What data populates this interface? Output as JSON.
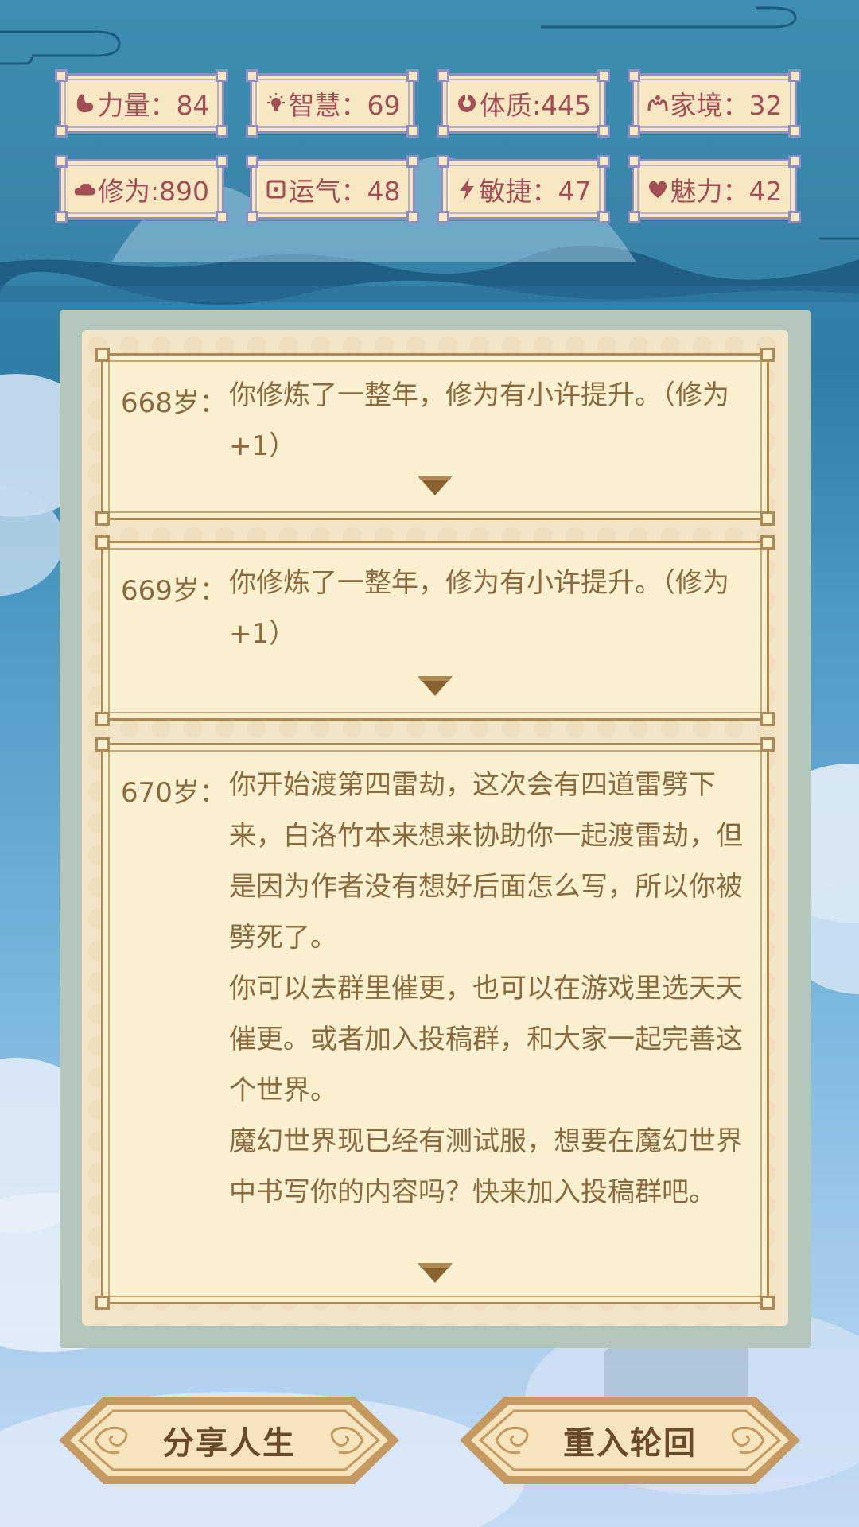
{
  "stats": [
    {
      "icon": "arm-icon",
      "text": "力量：84"
    },
    {
      "icon": "bulb-icon",
      "text": "智慧：69"
    },
    {
      "icon": "body-icon",
      "text": "体质:445"
    },
    {
      "icon": "family-icon",
      "text": "家境：32"
    },
    {
      "icon": "cloud-icon",
      "text": "修为:890"
    },
    {
      "icon": "luck-icon",
      "text": "运气：48"
    },
    {
      "icon": "lightning-icon",
      "text": "敏捷：47"
    },
    {
      "icon": "heart-icon",
      "text": "魅力：42"
    }
  ],
  "log": [
    {
      "age": "668岁：",
      "lines": [
        "你修炼了一整年，修为有小许提升。（修为+1）"
      ]
    },
    {
      "age": "669岁：",
      "lines": [
        "你修炼了一整年，修为有小许提升。（修为+1）"
      ]
    },
    {
      "age": "670岁：",
      "lines": [
        "你开始渡第四雷劫，这次会有四道雷劈下来，白洛竹本来想来协助你一起渡雷劫，但是因为作者没有想好后面怎么写，所以你被劈死了。",
        "你可以去群里催更，也可以在游戏里选天天催更。或者加入投稿群，和大家一起完善这个世界。",
        "魔幻世界现已经有测试服，想要在魔幻世界中书写你的内容吗？快来加入投稿群吧。"
      ]
    }
  ],
  "buttons": {
    "share": "分享人生",
    "restart": "重入轮回"
  },
  "colors": {
    "stat_text": "#a14f55",
    "stat_border": "#8e8fc0",
    "log_text": "#8a6a3e",
    "button_text": "#6a4a2a"
  }
}
